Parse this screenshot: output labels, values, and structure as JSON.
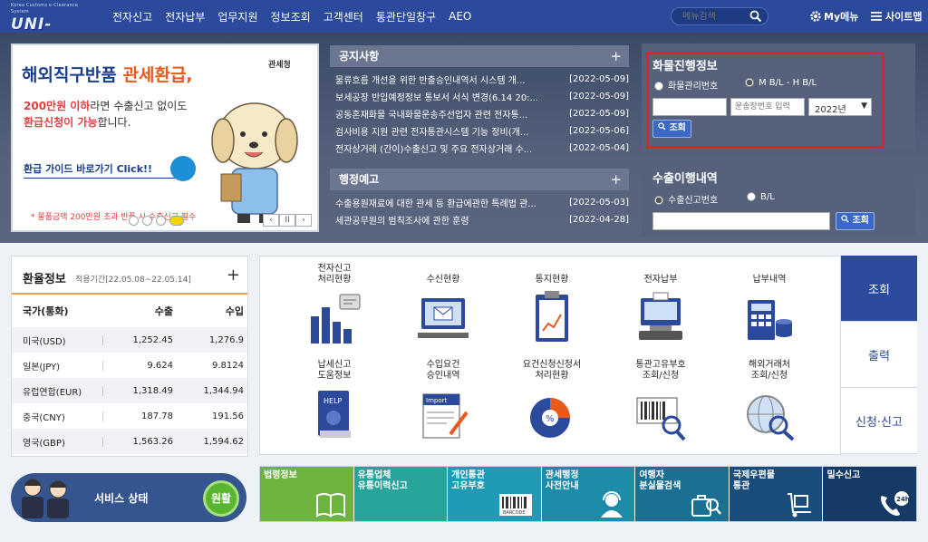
{
  "header": {
    "logo_small": "Korea Customs e-Clearance System",
    "logo": "UNI-PASS",
    "menu": [
      "전자신고",
      "전자납부",
      "업무지원",
      "정보조회",
      "고객센터",
      "통관단일창구",
      "AEO"
    ],
    "search_placeholder": "메뉴검색",
    "mymenu": "My메뉴",
    "sitemap": "사이트맵"
  },
  "banner": {
    "title_a": "해외직구반품 ",
    "title_b": "관세환급,",
    "line2_a": "200만원 이하",
    "line2_b": "라면 수출신고 없이도",
    "line3_a": "환급신청이 가능",
    "line3_b": "합니다.",
    "guide": "환급 가이드 바로가기 Click!!",
    "note": "* 물품금액 200만원 초과 반품 시 수출신고 필수",
    "agency": "관세청",
    "controls": [
      "‹",
      "II",
      "›"
    ]
  },
  "notices": {
    "title": "공지사항",
    "plus": "+",
    "items": [
      {
        "text": "물류흐름 개선을 위한 반출승인내역서 시스템 개...",
        "date": "[2022-05-09]"
      },
      {
        "text": "보세공장 반입예정정보 통보서 서식 변경(6.14 20:...",
        "date": "[2022-05-09]"
      },
      {
        "text": "공동혼재화물 국내화물운송주선업자 관련 전자통...",
        "date": "[2022-05-09]"
      },
      {
        "text": "검사비용 지원 관련 전자통관시스템 기능 정비(개...",
        "date": "[2022-05-06]"
      },
      {
        "text": "전자상거래 (간이)수출신고 및 주요 전자상거래 수...",
        "date": "[2022-05-04]"
      }
    ]
  },
  "admin_notices": {
    "title": "행정예고",
    "plus": "+",
    "items": [
      {
        "text": "수출용원재료에 대한 관세 등 환급에관한 특례법 관...",
        "date": "[2022-05-03]"
      },
      {
        "text": "세관공무원의 범칙조사에 관한 훈령",
        "date": "[2022-04-28]"
      }
    ]
  },
  "cargo": {
    "title": "화물진행정보",
    "radio1": "화물관리번호",
    "radio2": "M B/L - H B/L",
    "input2_placeholder": "운송장번호 입력",
    "year": "2022년",
    "search": "조회"
  },
  "export": {
    "title": "수출이행내역",
    "radio1": "수출신고번호",
    "radio2": "B/L",
    "search": "조회"
  },
  "rates": {
    "title": "환율정보",
    "period": "적용기간[22.05.08~22.05.14]",
    "plus": "+",
    "col_currency": "국가(통화)",
    "col_export": "수출",
    "col_import": "수입",
    "rows": [
      {
        "currency": "미국(USD)",
        "export": "1,252.45",
        "import": "1,276.9"
      },
      {
        "currency": "일본(JPY)",
        "export": "9.624",
        "import": "9.8124"
      },
      {
        "currency": "유럽연합(EUR)",
        "export": "1,318.49",
        "import": "1,344.94"
      },
      {
        "currency": "중국(CNY)",
        "export": "187.78",
        "import": "191.56"
      },
      {
        "currency": "영국(GBP)",
        "export": "1,563.26",
        "import": "1,594.62"
      }
    ]
  },
  "services": {
    "items": [
      {
        "l1": "전자신고",
        "l2": "처리현황"
      },
      {
        "l1": "",
        "l2": "수신현황"
      },
      {
        "l1": "",
        "l2": "통지현황"
      },
      {
        "l1": "",
        "l2": "전자납부"
      },
      {
        "l1": "",
        "l2": "납부내역"
      },
      {
        "l1": "납세신고",
        "l2": "도움정보"
      },
      {
        "l1": "수입요건",
        "l2": "승인내역"
      },
      {
        "l1": "요건신청신청서",
        "l2": "처리현황"
      },
      {
        "l1": "통관고유부호",
        "l2": "조회/신청"
      },
      {
        "l1": "해외거래처",
        "l2": "조회/신청"
      }
    ],
    "tabs": [
      "조회",
      "출력",
      "신청·신고"
    ]
  },
  "status": {
    "label": "서비스 상태",
    "value": "원활"
  },
  "tiles": [
    {
      "l1": "법령정보",
      "l2": "",
      "color": "#6db33f"
    },
    {
      "l1": "유통업체",
      "l2": "유통이력신고",
      "color": "#27a59a"
    },
    {
      "l1": "개인통관",
      "l2": "고유부호",
      "color": "#1f9bb5"
    },
    {
      "l1": "관세행정",
      "l2": "사전안내",
      "color": "#1d8ca9"
    },
    {
      "l1": "여행자",
      "l2": "분실물검색",
      "color": "#1a6f93"
    },
    {
      "l1": "국제우편물",
      "l2": "통관",
      "color": "#1b4d7a"
    },
    {
      "l1": "밀수신고",
      "l2": "",
      "color": "#163a66"
    }
  ],
  "tile_misc": {
    "barcode": "BARCODE",
    "h24": "24h"
  }
}
